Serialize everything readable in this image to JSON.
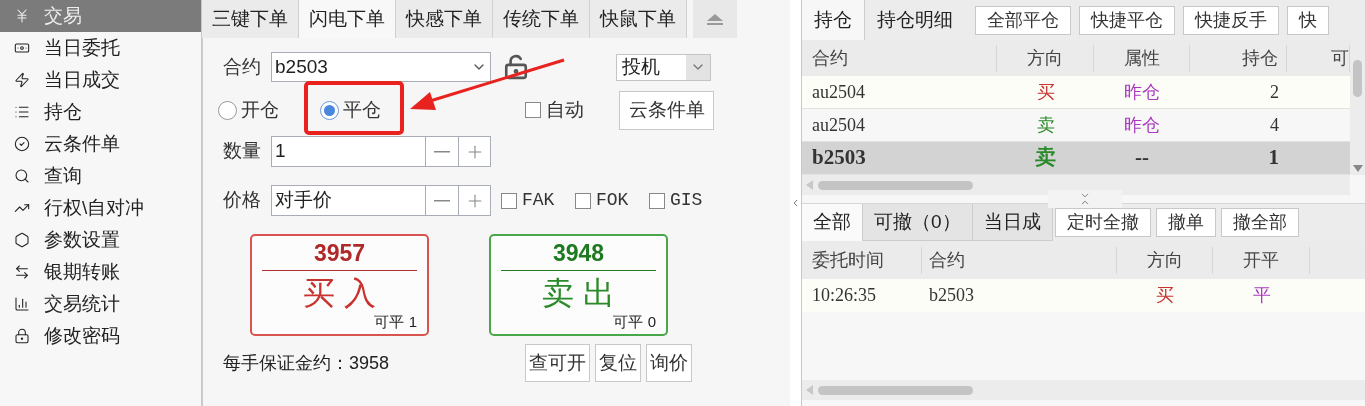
{
  "sidebar": {
    "items": [
      {
        "label": "交易",
        "selected": true
      },
      {
        "label": "当日委托",
        "selected": false
      },
      {
        "label": "当日成交",
        "selected": false
      },
      {
        "label": "持仓",
        "selected": false
      },
      {
        "label": "云条件单",
        "selected": false
      },
      {
        "label": "查询",
        "selected": false
      },
      {
        "label": "行权\\自对冲",
        "selected": false
      },
      {
        "label": "参数设置",
        "selected": false
      },
      {
        "label": "银期转账",
        "selected": false
      },
      {
        "label": "交易统计",
        "selected": false
      },
      {
        "label": "修改密码",
        "selected": false
      }
    ]
  },
  "order_panel": {
    "tabs": [
      {
        "label": "三键下单",
        "selected": false
      },
      {
        "label": "闪电下单",
        "selected": true
      },
      {
        "label": "快感下单",
        "selected": false
      },
      {
        "label": "传统下单",
        "selected": false
      },
      {
        "label": "快鼠下单",
        "selected": false
      }
    ],
    "contract_label": "合约",
    "contract_value": "b2503",
    "hedge_value": "投机",
    "offset_options": [
      {
        "label": "开仓",
        "selected": false
      },
      {
        "label": "平仓",
        "selected": true
      }
    ],
    "auto": {
      "label": "自动",
      "checked": false
    },
    "cloud_button": "云条件单",
    "quantity_label": "数量",
    "quantity_value": "1",
    "price_label": "价格",
    "price_value": "对手价",
    "flags": [
      {
        "label": "FAK",
        "checked": false
      },
      {
        "label": "FOK",
        "checked": false
      },
      {
        "label": "GIS",
        "checked": false
      }
    ],
    "trade_buttons": [
      {
        "kind": "buy",
        "price": "3957",
        "label": "买 入",
        "available": "可平 1"
      },
      {
        "kind": "sell",
        "price": "3948",
        "label": "卖 出",
        "available": "可平 0"
      }
    ],
    "margin_text": "每手保证金约：3958",
    "buttons": [
      "查可开",
      "复位",
      "询价"
    ]
  },
  "positions": {
    "tabs": [
      {
        "label": "持仓",
        "selected": true
      },
      {
        "label": "持仓明细",
        "selected": false
      }
    ],
    "buttons": [
      "全部平仓",
      "快捷平仓",
      "快捷反手",
      "快"
    ],
    "columns": [
      "合约",
      "方向",
      "属性",
      "持仓",
      "可"
    ],
    "rows": [
      {
        "contract": "au2504",
        "direction": {
          "text": "买",
          "color": "#c8332f"
        },
        "attribute": {
          "text": "昨仓",
          "color": "#a83ac0"
        },
        "quantity": "2",
        "selected": false
      },
      {
        "contract": "au2504",
        "direction": {
          "text": "卖",
          "color": "#2a8a2a"
        },
        "attribute": {
          "text": "昨仓",
          "color": "#a83ac0"
        },
        "quantity": "4",
        "selected": false
      },
      {
        "contract": "b2503",
        "direction": {
          "text": "卖",
          "color": "#2a8a2a"
        },
        "attribute": {
          "text": "--",
          "color": "#333333"
        },
        "quantity": "1",
        "selected": true
      }
    ]
  },
  "orders": {
    "tabs": [
      {
        "label": "全部",
        "selected": true
      },
      {
        "label": "可撤（0）",
        "selected": false
      },
      {
        "label": "当日成",
        "selected": false
      }
    ],
    "buttons": [
      "定时全撤",
      "撤单",
      "撤全部"
    ],
    "columns": [
      "委托时间",
      "合约",
      "方向",
      "开平"
    ],
    "rows": [
      {
        "time": "10:26:35",
        "contract": "b2503",
        "direction": {
          "text": "买",
          "color": "#c8332f"
        },
        "offset": "平"
      }
    ]
  }
}
